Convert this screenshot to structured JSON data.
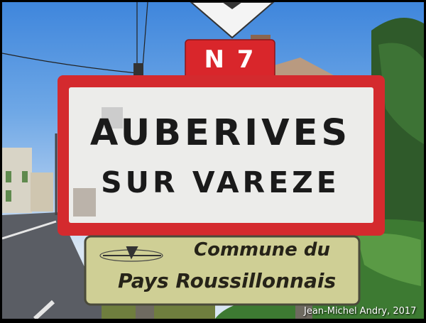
{
  "route_sign": {
    "label": "N 7",
    "color": "#d9262b"
  },
  "town_sign": {
    "line1": "AUBERIVES",
    "line2": "SUR VAREZE",
    "border_color": "#d42a2e"
  },
  "subsign": {
    "line1": "Commune du",
    "line2": "Pays Roussillonnais",
    "logo_icon": "airplane-logo-icon"
  },
  "credit": "Jean-Michel Andry, 2017"
}
